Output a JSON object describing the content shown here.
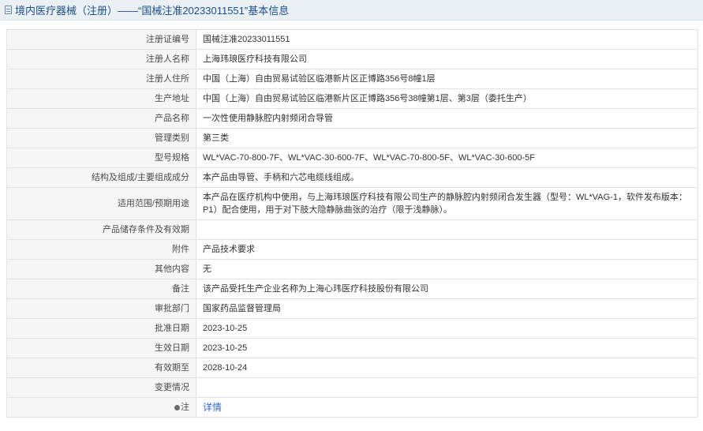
{
  "header": {
    "title": "境内医疗器械（注册）——“国械注准20233011551”基本信息"
  },
  "rows": [
    {
      "label": "注册证编号",
      "value": "国械注准20233011551"
    },
    {
      "label": "注册人名称",
      "value": "上海玮琅医疗科技有限公司"
    },
    {
      "label": "注册人住所",
      "value": "中国（上海）自由贸易试验区临港新片区正博路356号8幢1层"
    },
    {
      "label": "生产地址",
      "value": "中国（上海）自由贸易试验区临港新片区正博路356号38幢第1层、第3层（委托生产）"
    },
    {
      "label": "产品名称",
      "value": "一次性使用静脉腔内射频闭合导管"
    },
    {
      "label": "管理类别",
      "value": "第三类"
    },
    {
      "label": "型号规格",
      "value": "WL*VAC-70-800-7F、WL*VAC-30-600-7F、WL*VAC-70-800-5F、WL*VAC-30-600-5F"
    },
    {
      "label": "结构及组成/主要组成成分",
      "value": "本产品由导管、手柄和六芯电缆线组成。"
    },
    {
      "label": "适用范围/预期用途",
      "value": "本产品在医疗机构中使用，与上海玮琅医疗科技有限公司生产的静脉腔内射频闭合发生器（型号：WL*VAG-1，软件发布版本：P1）配合使用，用于对下肢大隐静脉曲张的治疗（限于浅静脉）。"
    },
    {
      "label": "产品储存条件及有效期",
      "value": ""
    },
    {
      "label": "附件",
      "value": "产品技术要求"
    },
    {
      "label": "其他内容",
      "value": "无"
    },
    {
      "label": "备注",
      "value": "该产品受托生产企业名称为上海心玮医疗科技股份有限公司"
    },
    {
      "label": "审批部门",
      "value": "国家药品监督管理局"
    },
    {
      "label": "批准日期",
      "value": "2023-10-25"
    },
    {
      "label": "生效日期",
      "value": "2023-10-25"
    },
    {
      "label": "有效期至",
      "value": "2028-10-24"
    },
    {
      "label": "变更情况",
      "value": ""
    }
  ],
  "note_row": {
    "label": "注",
    "link_text": "详情"
  },
  "icons": {
    "header": "document-icon",
    "note": "pin-icon"
  }
}
